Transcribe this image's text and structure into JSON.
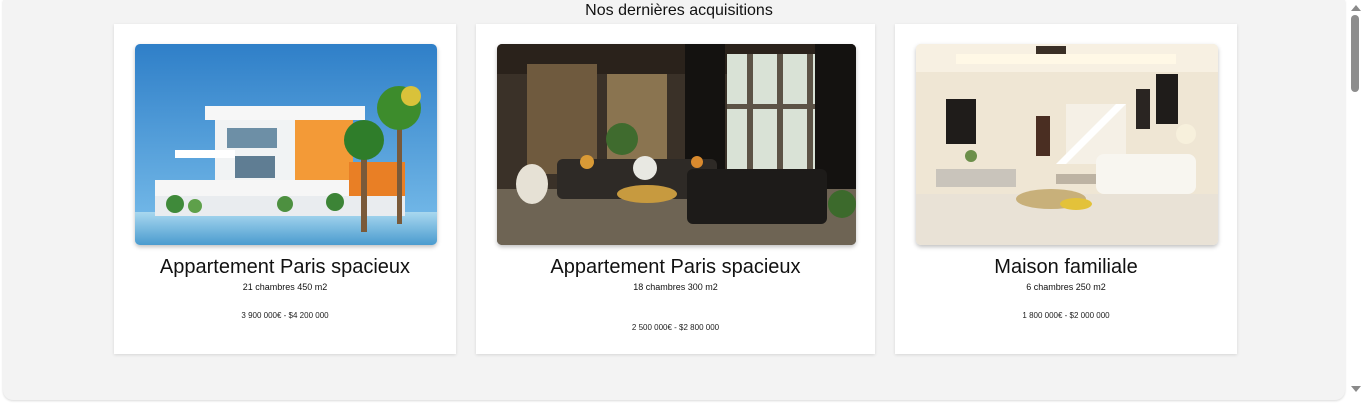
{
  "section": {
    "title": "Nos dernières acquisitions"
  },
  "listings": [
    {
      "name": "Appartement Paris spacieux",
      "specs": "21 chambres 450 m2",
      "price": "3 900 000€ - $4 200 000",
      "image": "modern-villa-by-pool"
    },
    {
      "name": "Appartement Paris spacieux",
      "specs": "18 chambres 300 m2",
      "price": "2 500 000€ - $2 800 000",
      "image": "luxury-living-room"
    },
    {
      "name": "Maison familiale",
      "specs": "6 chambres 250 m2",
      "price": "1 800 000€ - $2 000 000",
      "image": "bright-living-room-staircase"
    }
  ],
  "colors": {
    "page_background": "#f3f3f3",
    "card_background": "#ffffff",
    "text": "#111111",
    "scrollbar_thumb": "#8d8d8d"
  }
}
